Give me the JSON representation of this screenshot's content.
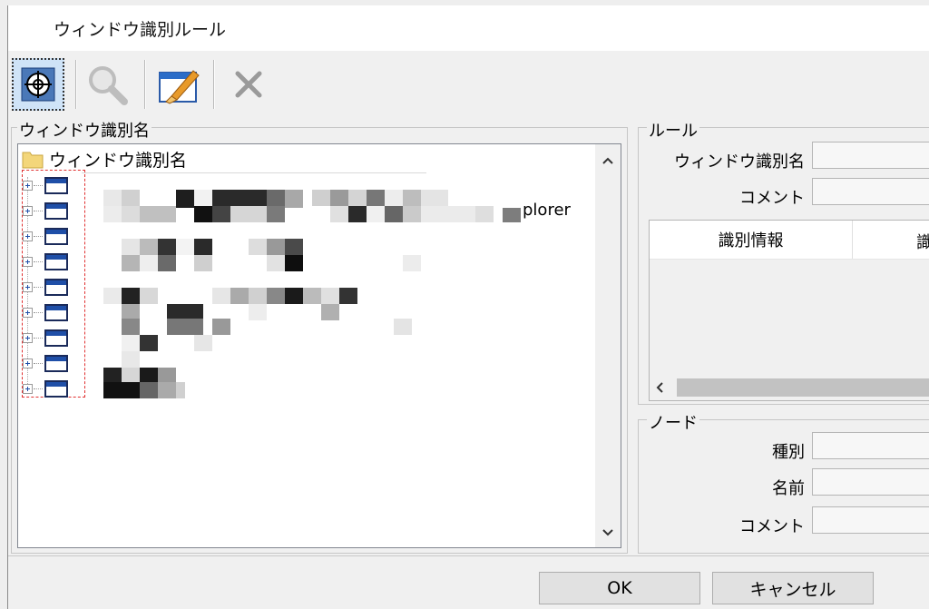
{
  "window": {
    "title": "ウィンドウ識別ルール"
  },
  "toolbar": {
    "buttons": [
      {
        "name": "target-capture",
        "icon": "crosshair-target-icon",
        "active": true
      },
      {
        "name": "search",
        "icon": "magnifier-icon",
        "active": false
      },
      {
        "name": "edit",
        "icon": "window-brush-icon",
        "active": false
      },
      {
        "name": "delete",
        "icon": "x-delete-icon",
        "active": false
      }
    ]
  },
  "left_panel": {
    "group_title": "ウィンドウ識別名",
    "tree": {
      "root_label": "ウィンドウ識別名",
      "visible_fragment": "plorer",
      "node_count": 9
    }
  },
  "rule_panel": {
    "group_title": "ルール",
    "name_label": "ウィンドウ識別名",
    "comment_label": "コメント",
    "columns": [
      "識別情報",
      "識"
    ]
  },
  "node_panel": {
    "group_title": "ノード",
    "type_label": "種別",
    "name_label": "名前",
    "comment_label": "コメント"
  },
  "footer": {
    "ok_label": "OK",
    "cancel_label": "キャンセル"
  },
  "colors": {
    "highlight": "#cfe3f7",
    "annotation_red": "#e03030",
    "folder": "#f3d67a"
  }
}
